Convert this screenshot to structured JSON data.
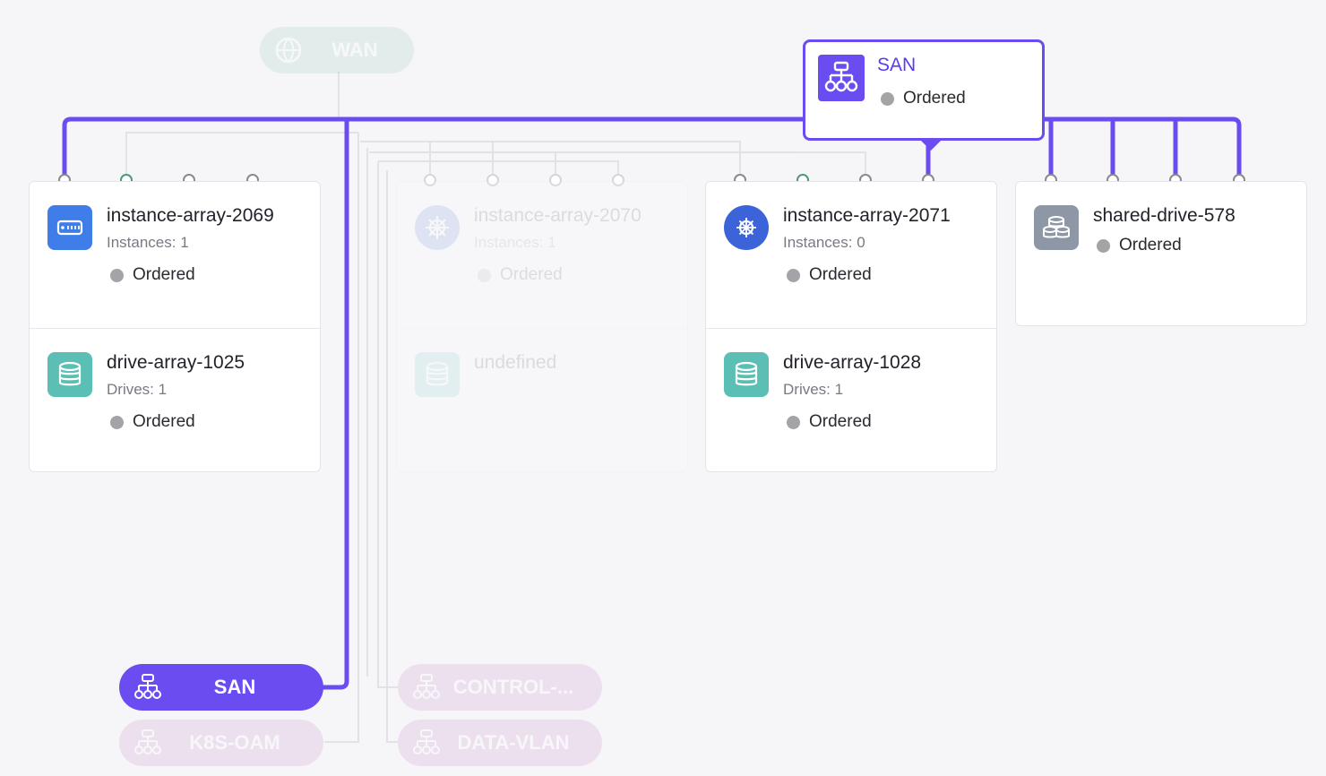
{
  "wan_pill": {
    "label": "WAN"
  },
  "popup": {
    "name": "SAN",
    "status": "Ordered"
  },
  "cards": {
    "ia2069": {
      "name": "instance-array-2069",
      "sub": "Instances: 1",
      "status": "Ordered"
    },
    "da1025": {
      "name": "drive-array-1025",
      "sub": "Drives: 1",
      "status": "Ordered"
    },
    "ia2070": {
      "name": "instance-array-2070",
      "sub": "Instances: 1",
      "status": "Ordered"
    },
    "undef": {
      "name": "undefined"
    },
    "ia2071": {
      "name": "instance-array-2071",
      "sub": "Instances: 0",
      "status": "Ordered"
    },
    "da1028": {
      "name": "drive-array-1028",
      "sub": "Drives: 1",
      "status": "Ordered"
    },
    "sd578": {
      "name": "shared-drive-578",
      "status": "Ordered"
    }
  },
  "networks": {
    "san": {
      "label": "SAN"
    },
    "k8s_oam": {
      "label": "K8S-OAM"
    },
    "control": {
      "label": "CONTROL-..."
    },
    "data_vlan": {
      "label": "DATA-VLAN"
    }
  },
  "colors": {
    "accent": "#6a4cf0",
    "port_active": "#4e9a78",
    "port": "#8a8a90",
    "status_dot": "#a3a3a8"
  }
}
